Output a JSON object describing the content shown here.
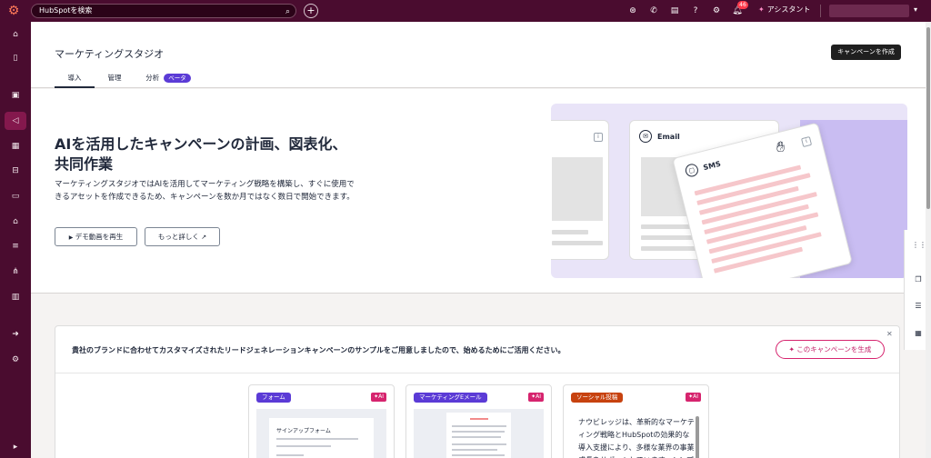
{
  "topbar": {
    "search_placeholder": "HubSpotを検索",
    "assistant_label": "アシスタント",
    "notification_count": "46"
  },
  "sidebar": {
    "items": [
      {
        "icon": "home-icon"
      },
      {
        "icon": "bookmark-icon"
      },
      {
        "icon": "contacts-icon"
      },
      {
        "icon": "megaphone-icon",
        "active": true
      },
      {
        "icon": "content-icon"
      },
      {
        "icon": "commerce-icon"
      },
      {
        "icon": "service-icon"
      },
      {
        "icon": "automation-icon"
      },
      {
        "icon": "data-icon"
      },
      {
        "icon": "integrations-icon"
      },
      {
        "icon": "reports-icon"
      },
      {
        "icon": "apps-icon"
      },
      {
        "icon": "settings-icon"
      },
      {
        "icon": "expand-icon"
      }
    ]
  },
  "header": {
    "title": "マーケティングスタジオ",
    "create_button": "キャンペーンを作成",
    "tabs": [
      {
        "label": "導入",
        "active": true
      },
      {
        "label": "管理"
      },
      {
        "label": "分析",
        "badge": "ベータ"
      }
    ]
  },
  "hero": {
    "title": "AIを活用したキャンペーンの計画、図表化、共同作業",
    "description": "マーケティングスタジオではAIを活用してマーケティング戦略を構築し、すぐに使用できるアセットを作成できるため、キャンペーンを数か月ではなく数日で開始できます。",
    "demo_button": "デモ動画を再生",
    "more_button": "もっと詳しく",
    "illustration": {
      "email_label": "Email",
      "sms_label": "SMS",
      "info_glyph": "i"
    }
  },
  "suggestion": {
    "text": "貴社のブランドに合わせてカスタマイズされたリードジェネレーションキャンペーンのサンプルをご用意しましたので、始めるためにご活用ください。",
    "generate_button": "このキャンペーンを生成",
    "templates": [
      {
        "tag": "フォーム",
        "tag_color": "#5b3bd6",
        "ai": "AI",
        "preview_title": "サインアップフォーム"
      },
      {
        "tag": "マーケティングEメール",
        "tag_color": "#5b3bd6",
        "ai": "AI"
      },
      {
        "tag": "ソーシャル投稿",
        "tag_color": "#c7420f",
        "ai": "AI",
        "preview_text": "ナウビレッジは、革新的なマーケティング戦略とHubSpotの効果的な導入支援により、多様な業界の事業成長をサポートしています。シンプル"
      }
    ]
  },
  "colors": {
    "nav_bg": "#4a0c2f",
    "accent_pink": "#d6246e",
    "beta_purple": "#5b3bd6",
    "illustration_bg": "#e9e4f8"
  }
}
